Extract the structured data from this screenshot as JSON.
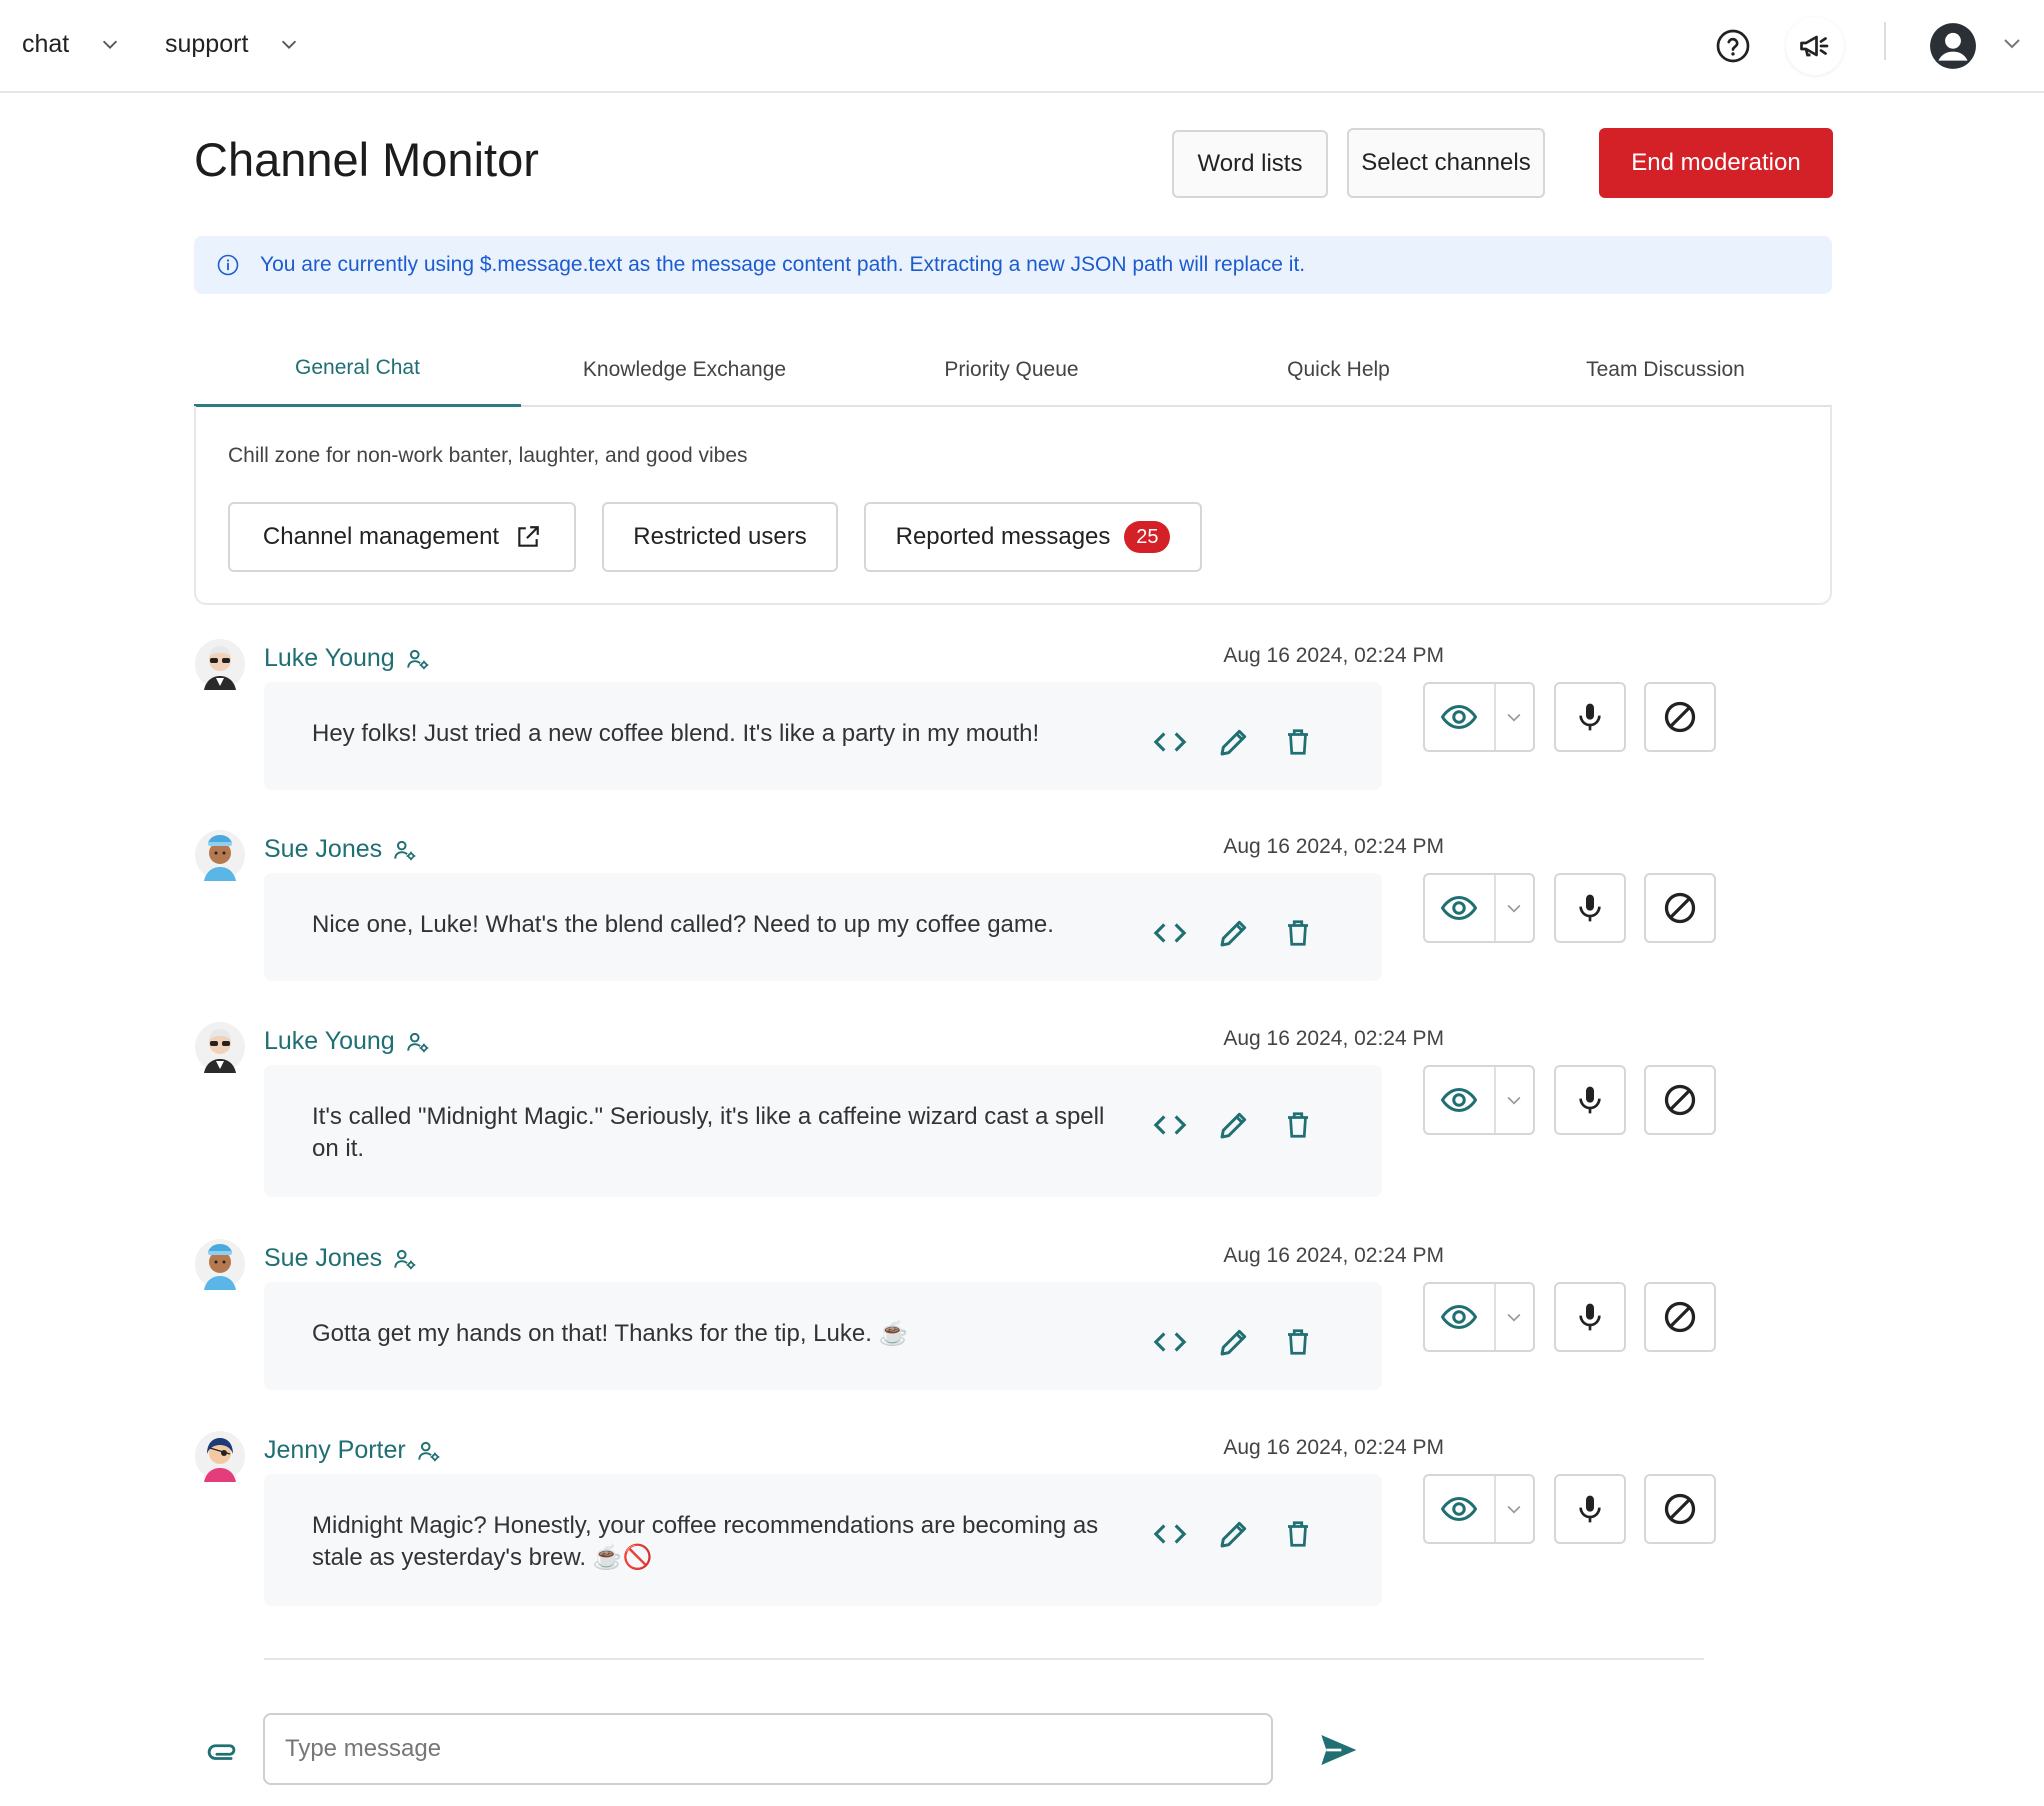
{
  "nav": {
    "chat_label": "chat",
    "support_label": "support"
  },
  "header": {
    "title": "Channel Monitor",
    "word_lists": "Word lists",
    "select_channels": "Select channels",
    "end_moderation": "End moderation"
  },
  "banner": {
    "text": "You are currently using $.message.text as the message content path. Extracting a new JSON path will replace it."
  },
  "tabs": [
    {
      "label": "General Chat",
      "active": true
    },
    {
      "label": "Knowledge Exchange",
      "active": false
    },
    {
      "label": "Priority Queue",
      "active": false
    },
    {
      "label": "Quick Help",
      "active": false
    },
    {
      "label": "Team Discussion",
      "active": false
    }
  ],
  "channel": {
    "description": "Chill zone for non-work banter, laughter, and good vibes",
    "manage_label": "Channel management",
    "restricted_label": "Restricted users",
    "reported_label": "Reported messages",
    "reported_count": "25"
  },
  "messages": [
    {
      "user": "Luke Young",
      "avatar": "man-sunglasses",
      "time": "Aug 16 2024, 02:24 PM",
      "text": "Hey folks! Just tried a new coffee blend. It's like a party in my mouth!"
    },
    {
      "user": "Sue Jones",
      "avatar": "woman-headband",
      "time": "Aug 16 2024, 02:24 PM",
      "text": "Nice one, Luke! What's the blend called? Need to up my coffee game."
    },
    {
      "user": "Luke Young",
      "avatar": "man-sunglasses",
      "time": "Aug 16 2024, 02:24 PM",
      "text": "It's called \"Midnight Magic.\" Seriously, it's like a caffeine wizard cast a spell on it."
    },
    {
      "user": "Sue Jones",
      "avatar": "woman-headband",
      "time": "Aug 16 2024, 02:24 PM",
      "text": "Gotta get my hands on that! Thanks for the tip, Luke. ☕"
    },
    {
      "user": "Jenny Porter",
      "avatar": "woman-eyepatch",
      "time": "Aug 16 2024, 02:24 PM",
      "text": "Midnight Magic? Honestly, your coffee recommendations are becoming as stale as yesterday's brew. ☕🚫"
    }
  ],
  "composer": {
    "placeholder": "Type message"
  },
  "colors": {
    "accent": "#1f6f73",
    "danger": "#d42027",
    "banner_bg": "#eaf3fd",
    "banner_text": "#1d5bd1"
  }
}
